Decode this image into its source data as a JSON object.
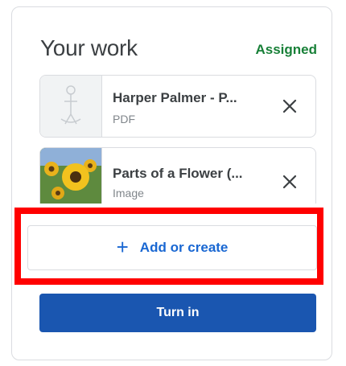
{
  "panel": {
    "title": "Your work",
    "status": "Assigned"
  },
  "attachments": [
    {
      "name": "Harper Palmer - P...",
      "type": "PDF",
      "thumb_icon": "pdf-thumbnail-icon",
      "remove_icon": "close-icon"
    },
    {
      "name": "Parts of a Flower (...",
      "type": "Image",
      "thumb_icon": "sunflower-image-thumbnail",
      "remove_icon": "close-icon"
    }
  ],
  "actions": {
    "add_icon": "+",
    "add_label": "Add or create",
    "turn_in_label": "Turn in"
  },
  "colors": {
    "status": "#188038",
    "add_text": "#1967d2",
    "turn_in_bg": "#1a56b0",
    "highlight": "#ff0000"
  }
}
